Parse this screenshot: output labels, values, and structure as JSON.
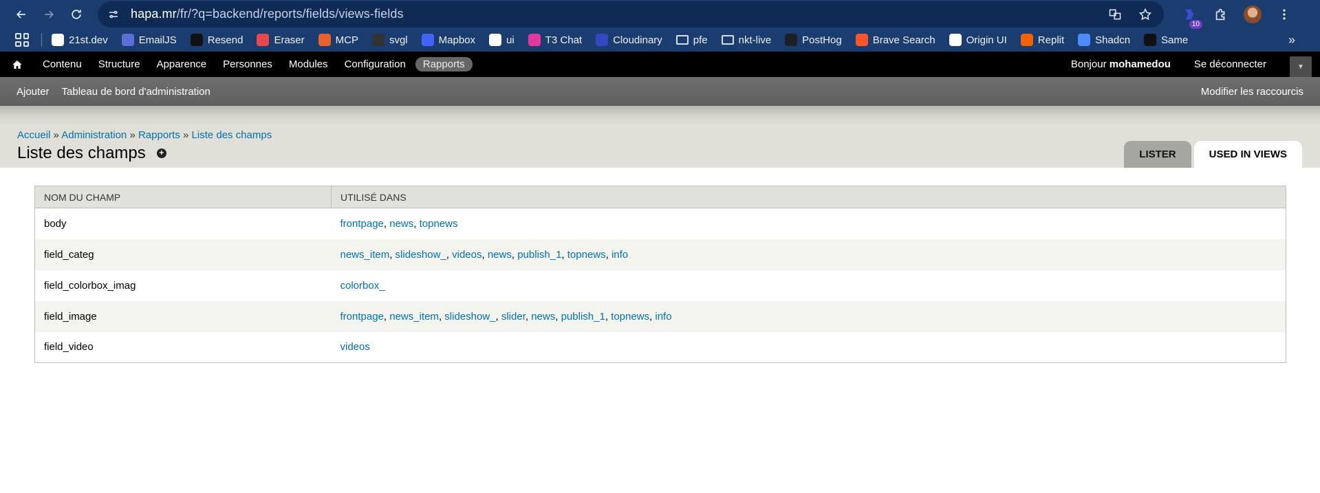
{
  "browser": {
    "url_host": "hapa.mr",
    "url_path": "/fr/?q=backend/reports/fields/views-fields",
    "extension_badge": "10"
  },
  "bookmarks": [
    {
      "label": "21st.dev",
      "color": "#ffffff"
    },
    {
      "label": "EmailJS",
      "color": "#5b6fd6"
    },
    {
      "label": "Resend",
      "color": "#111111"
    },
    {
      "label": "Eraser",
      "color": "#e5484d"
    },
    {
      "label": "MCP",
      "color": "#e8622c"
    },
    {
      "label": "svgl",
      "color": "#333333"
    },
    {
      "label": "Mapbox",
      "color": "#4264fb"
    },
    {
      "label": "ui",
      "color": "#ffffff"
    },
    {
      "label": "T3 Chat",
      "color": "#e0389c"
    },
    {
      "label": "Cloudinary",
      "color": "#3448c5"
    },
    {
      "label": "pfe",
      "color": "folder"
    },
    {
      "label": "nkt-live",
      "color": "folder"
    },
    {
      "label": "PostHog",
      "color": "#1d1f27"
    },
    {
      "label": "Brave Search",
      "color": "#fb542b"
    },
    {
      "label": "Origin UI",
      "color": "#ffffff"
    },
    {
      "label": "Replit",
      "color": "#f26207"
    },
    {
      "label": "Shadcn",
      "color": "#4a8cff"
    },
    {
      "label": "Same",
      "color": "#111111"
    }
  ],
  "toolbar": {
    "items": [
      "Contenu",
      "Structure",
      "Apparence",
      "Personnes",
      "Modules",
      "Configuration",
      "Rapports"
    ],
    "active": "Rapports",
    "greeting": "Bonjour",
    "username": "mohamedou",
    "logout": "Se déconnecter"
  },
  "shortcuts": {
    "items": [
      "Ajouter",
      "Tableau de bord d'administration"
    ],
    "edit": "Modifier les raccourcis"
  },
  "breadcrumb": [
    "Accueil",
    "Administration",
    "Rapports",
    "Liste des champs"
  ],
  "breadcrumb_sep": "»",
  "page_title": "Liste des champs",
  "tabs": [
    {
      "label": "LISTER",
      "active": false
    },
    {
      "label": "USED IN VIEWS",
      "active": true
    }
  ],
  "table": {
    "headers": [
      "Nom du champ",
      "Utilisé dans"
    ],
    "rows": [
      {
        "field": "body",
        "views": [
          "frontpage",
          "news",
          "topnews"
        ]
      },
      {
        "field": "field_categ",
        "views": [
          "news_item",
          "slideshow_",
          "videos",
          "news",
          "publish_1",
          "topnews",
          "info"
        ]
      },
      {
        "field": "field_colorbox_imag",
        "views": [
          "colorbox_"
        ]
      },
      {
        "field": "field_image",
        "views": [
          "frontpage",
          "news_item",
          "slideshow_",
          "slider",
          "news",
          "publish_1",
          "topnews",
          "info"
        ]
      },
      {
        "field": "field_video",
        "views": [
          "videos"
        ]
      }
    ]
  }
}
